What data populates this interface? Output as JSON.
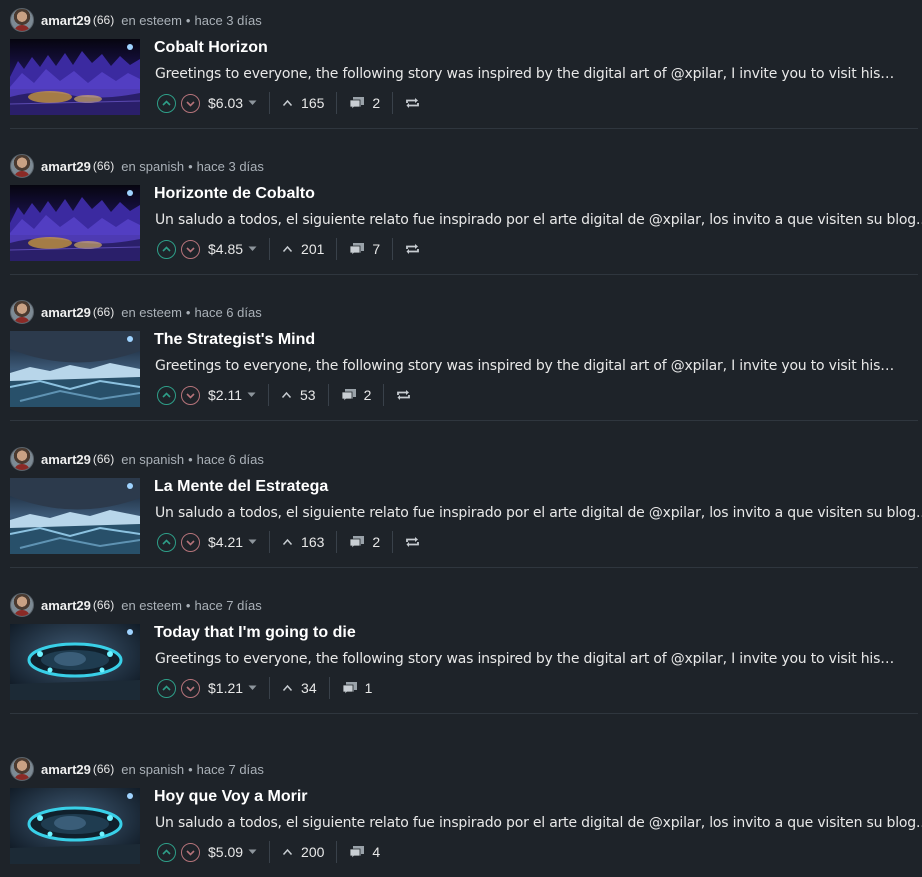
{
  "posts": [
    {
      "author": "amart29",
      "reputation": "(66)",
      "community": "en esteem",
      "time": "hace 3 días",
      "title": "Cobalt Horizon",
      "summary": "Greetings to everyone, the following story was inspired by the digital art of @xpilar, I invite you to visit his…",
      "payout": "$6.03",
      "votes": "165",
      "comments": "2",
      "has_resteem": true,
      "thumb": "cobalt"
    },
    {
      "author": "amart29",
      "reputation": "(66)",
      "community": "en spanish",
      "time": "hace 3 días",
      "title": "Horizonte de Cobalto",
      "summary": "Un saludo a todos, el siguiente relato fue inspirado por el arte digital de @xpilar, los invito a que visiten su blog.…",
      "payout": "$4.85",
      "votes": "201",
      "comments": "7",
      "has_resteem": true,
      "thumb": "cobalt"
    },
    {
      "author": "amart29",
      "reputation": "(66)",
      "community": "en esteem",
      "time": "hace 6 días",
      "title": "The Strategist's Mind",
      "summary": "Greetings to everyone, the following story was inspired by the digital art of @xpilar, I invite you to visit his…",
      "payout": "$2.11",
      "votes": "53",
      "comments": "2",
      "has_resteem": true,
      "thumb": "ice"
    },
    {
      "author": "amart29",
      "reputation": "(66)",
      "community": "en spanish",
      "time": "hace 6 días",
      "title": "La Mente del Estratega",
      "summary": "Un saludo a todos, el siguiente relato fue inspirado por el arte digital de @xpilar, los invito a que visiten su blog.…",
      "payout": "$4.21",
      "votes": "163",
      "comments": "2",
      "has_resteem": true,
      "thumb": "ice"
    },
    {
      "author": "amart29",
      "reputation": "(66)",
      "community": "en esteem",
      "time": "hace 7 días",
      "title": "Today that I'm going to die",
      "summary": "Greetings to everyone, the following story was inspired by the digital art of @xpilar, I invite you to visit his…",
      "payout": "$1.21",
      "votes": "34",
      "comments": "1",
      "has_resteem": false,
      "thumb": "ship"
    },
    {
      "author": "amart29",
      "reputation": "(66)",
      "community": "en spanish",
      "time": "hace 7 días",
      "title": "Hoy que Voy a Morir",
      "summary": "Un saludo a todos, el siguiente relato fue inspirado por el arte digital de @xpilar, los invito a que visiten su blog.…",
      "payout": "$5.09",
      "votes": "200",
      "comments": "4",
      "has_resteem": false,
      "thumb": "ship"
    }
  ],
  "colors": {
    "background": "#1e2329",
    "upvote": "#2e9e88",
    "downvote": "#b5737a",
    "divider": "#2f363e"
  }
}
